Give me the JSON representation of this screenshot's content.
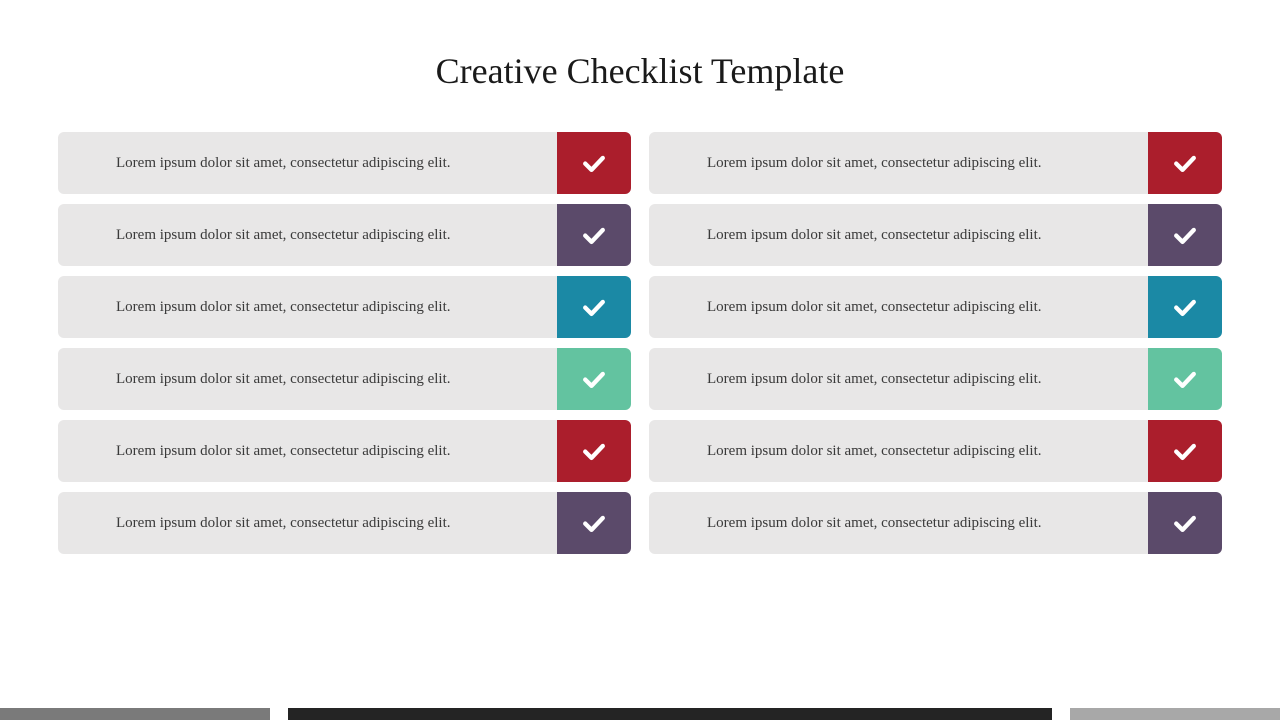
{
  "title": "Creative Checklist Template",
  "colors": {
    "red": "#ab1e2c",
    "purple": "#5b4a6a",
    "teal": "#1b89a5",
    "green": "#63c3a0"
  },
  "left": [
    {
      "text": "Lorem ipsum dolor sit amet, consectetur adipiscing elit.",
      "color": "red"
    },
    {
      "text": "Lorem ipsum dolor sit amet, consectetur adipiscing elit.",
      "color": "purple"
    },
    {
      "text": "Lorem ipsum dolor sit amet, consectetur adipiscing elit.",
      "color": "teal"
    },
    {
      "text": "Lorem ipsum dolor sit amet, consectetur adipiscing elit.",
      "color": "green"
    },
    {
      "text": "Lorem ipsum dolor sit amet, consectetur adipiscing elit.",
      "color": "red"
    },
    {
      "text": "Lorem ipsum dolor sit amet, consectetur adipiscing elit.",
      "color": "purple"
    }
  ],
  "right": [
    {
      "text": "Lorem ipsum dolor sit amet, consectetur adipiscing elit.",
      "color": "red"
    },
    {
      "text": "Lorem ipsum dolor sit amet, consectetur adipiscing elit.",
      "color": "purple"
    },
    {
      "text": "Lorem ipsum dolor sit amet, consectetur adipiscing elit.",
      "color": "teal"
    },
    {
      "text": "Lorem ipsum dolor sit amet, consectetur adipiscing elit.",
      "color": "green"
    },
    {
      "text": "Lorem ipsum dolor sit amet, consectetur adipiscing elit.",
      "color": "red"
    },
    {
      "text": "Lorem ipsum dolor sit amet, consectetur adipiscing elit.",
      "color": "purple"
    }
  ]
}
